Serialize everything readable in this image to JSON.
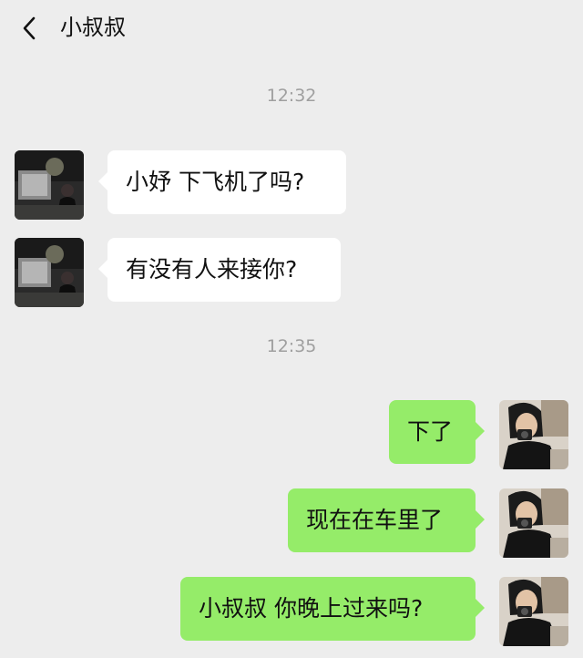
{
  "header": {
    "title": "小叔叔",
    "back_icon": "chevron-left-icon"
  },
  "timestamps": [
    "12:32",
    "12:35"
  ],
  "messages": [
    {
      "side": "incoming",
      "text": "小妤 下飞机了吗?"
    },
    {
      "side": "incoming",
      "text": "有没有人来接你?"
    },
    {
      "side": "outgoing",
      "text": "下了"
    },
    {
      "side": "outgoing",
      "text": "现在在车里了"
    },
    {
      "side": "outgoing",
      "text": "小叔叔 你晚上过来吗?"
    }
  ],
  "colors": {
    "background": "#ededed",
    "incoming_bubble": "#ffffff",
    "outgoing_bubble": "#95ec69"
  }
}
